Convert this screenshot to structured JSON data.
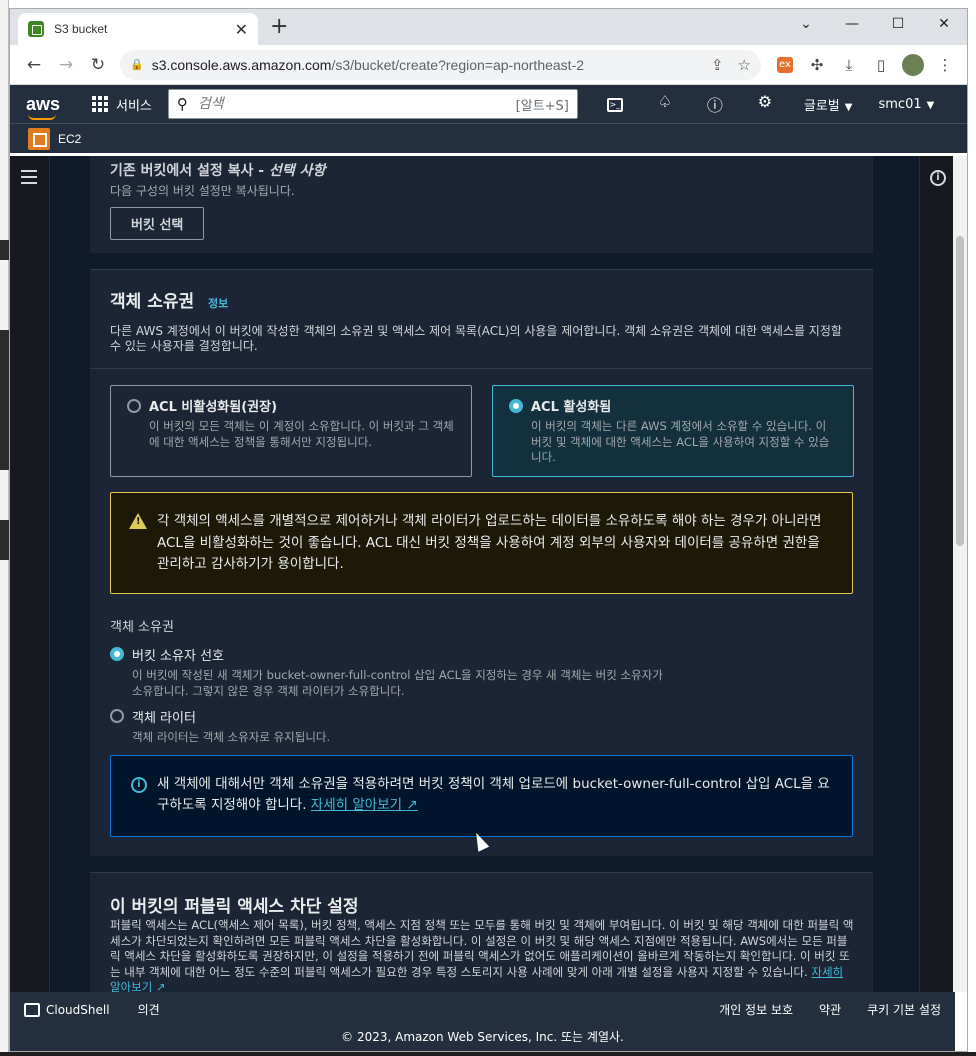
{
  "browser": {
    "tab_title": "S3 bucket",
    "url_host": "s3.console.aws.amazon.com",
    "url_path": "/s3/bucket/create?region=ap-northeast-2"
  },
  "aws_nav": {
    "logo": "aws",
    "services_label": "서비스",
    "search_placeholder": "검색",
    "search_shortcut": "[알트+S]",
    "region_label": "글로벌",
    "account_label": "smc01"
  },
  "favorites": {
    "ec2_label": "EC2"
  },
  "copy_settings": {
    "title": "기존 버킷에서 설정 복사 - ",
    "title_optional": "선택 사항",
    "description": "다음 구성의 버킷 설정만 복사됩니다.",
    "button_label": "버킷 선택"
  },
  "object_ownership": {
    "title": "객체 소유권",
    "info_label": "정보",
    "description": "다른 AWS 계정에서 이 버킷에 작성한 객체의 소유권 및 액세스 제어 목록(ACL)의 사용을 제어합니다. 객체 소유권은 객체에 대한 액세스를 지정할 수 있는 사용자를 결정합니다.",
    "tiles": [
      {
        "label": "ACL 비활성화됨(권장)",
        "description": "이 버킷의 모든 객체는 이 계정이 소유합니다. 이 버킷과 그 객체에 대한 액세스는 정책을 통해서만 지정됩니다.",
        "selected": false
      },
      {
        "label": "ACL 활성화됨",
        "description": "이 버킷의 객체는 다른 AWS 계정에서 소유할 수 있습니다. 이 버킷 및 객체에 대한 액세스는 ACL을 사용하여 지정할 수 있습니다.",
        "selected": true
      }
    ],
    "warning": "각 객체의 액세스를 개별적으로 제어하거나 객체 라이터가 업로드하는 데이터를 소유하도록 해야 하는 경우가 아니라면 ACL을 비활성화하는 것이 좋습니다. ACL 대신 버킷 정책을 사용하여 계정 외부의 사용자와 데이터를 공유하면 권한을 관리하고 감사하기가 용이합니다.",
    "group_label": "객체 소유권",
    "options": [
      {
        "label": "버킷 소유자 선호",
        "description": "이 버킷에 작성된 새 객체가 bucket-owner-full-control 삽입 ACL을 지정하는 경우 새 객체는 버킷 소유자가 소유합니다. 그렇지 않은 경우 객체 라이터가 소유합니다.",
        "selected": true
      },
      {
        "label": "객체 라이터",
        "description": "객체 라이터는 객체 소유자로 유지됩니다.",
        "selected": false
      }
    ],
    "info_text": "새 객체에 대해서만 객체 소유권을 적용하려면 버킷 정책이 객체 업로드에 bucket-owner-full-control 삽입 ACL을 요구하도록 지정해야 합니다. ",
    "info_link": "자세히 알아보기"
  },
  "block_public": {
    "title": "이 버킷의 퍼블릭 액세스 차단 설정",
    "description": "퍼블릭 액세스는 ACL(액세스 제어 목록), 버킷 정책, 액세스 지점 정책 또는 모두를 통해 버킷 및 객체에 부여됩니다. 이 버킷 및 해당 객체에 대한 퍼블릭 액세스가 차단되었는지 확인하려면 모든 퍼블릭 액세스 차단을 활성화합니다. 이 설정은 이 버킷 및 해당 액세스 지점에만 적용됩니다. AWS에서는 모든 퍼블릭 액세스 차단을 활성화하도록 권장하지만, 이 설정을 적용하기 전에 퍼블릭 액세스가 없어도 애플리케이션이 올바르게 작동하는지 확인합니다. 이 버킷 또는 내부 객체에 대한 어느 정도 수준의 퍼블릭 액세스가 필요한 경우 특정 스토리지 사용 사례에 맞게 아래 개별 설정을 사용자 지정할 수 있습니다. ",
    "link": "자세히 알아보기"
  },
  "footer": {
    "cloudshell": "CloudShell",
    "feedback": "의견",
    "privacy": "개인 정보 보호",
    "terms": "약관",
    "cookies": "쿠키 기본 설정",
    "copyright": "© 2023, Amazon Web Services, Inc. 또는 계열사."
  }
}
